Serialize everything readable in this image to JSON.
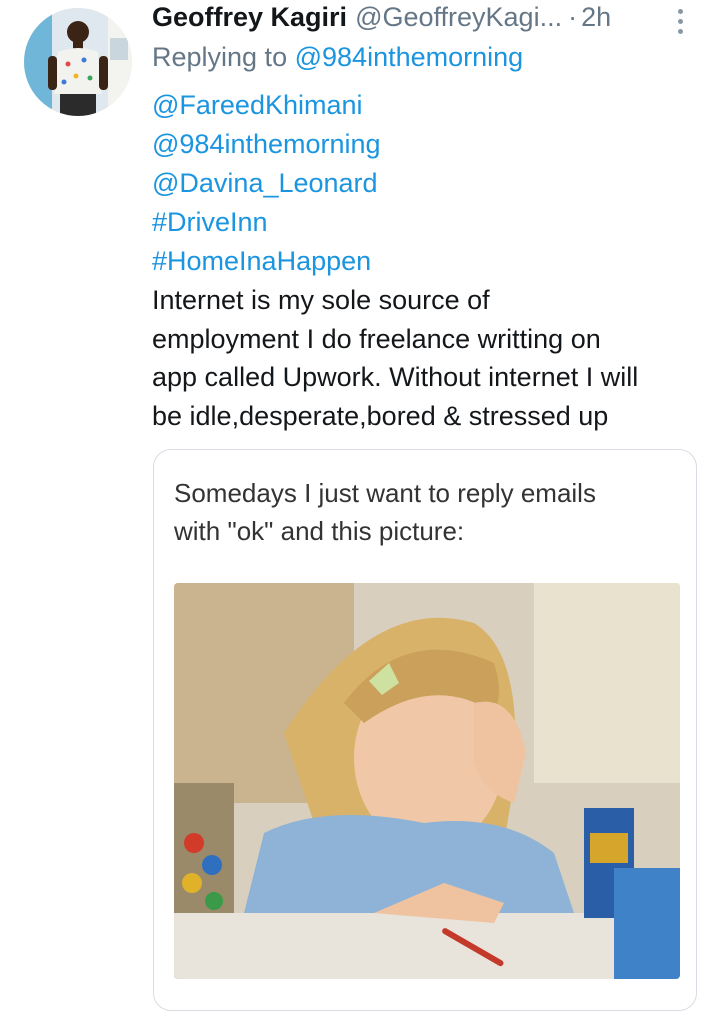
{
  "tweet": {
    "display_name": "Geoffrey Kagiri",
    "handle": "@GeoffreyKagi...",
    "separator": "·",
    "time": "2h",
    "replying_prefix": "Replying to",
    "replying_to": "@984inthemorning",
    "links": [
      "@FareedKhimani",
      "@984inthemorning",
      "@Davina_Leonard",
      "#DriveInn",
      "#HomeInaHappen"
    ],
    "body_lines": [
      "Internet is my sole source of",
      "employment I do freelance writting on",
      "app called Upwork. Without internet I will",
      "be idle,desperate,bored & stressed up"
    ]
  },
  "media": {
    "caption_lines": [
      "Somedays I just want to reply emails",
      "with \"ok\" and this picture:"
    ]
  },
  "colors": {
    "link": "#1b95e0",
    "secondary_text": "#657786",
    "primary_text": "#14171a",
    "card_border": "#d7dde2"
  },
  "icons": {
    "more": "vertical-ellipsis-icon"
  }
}
